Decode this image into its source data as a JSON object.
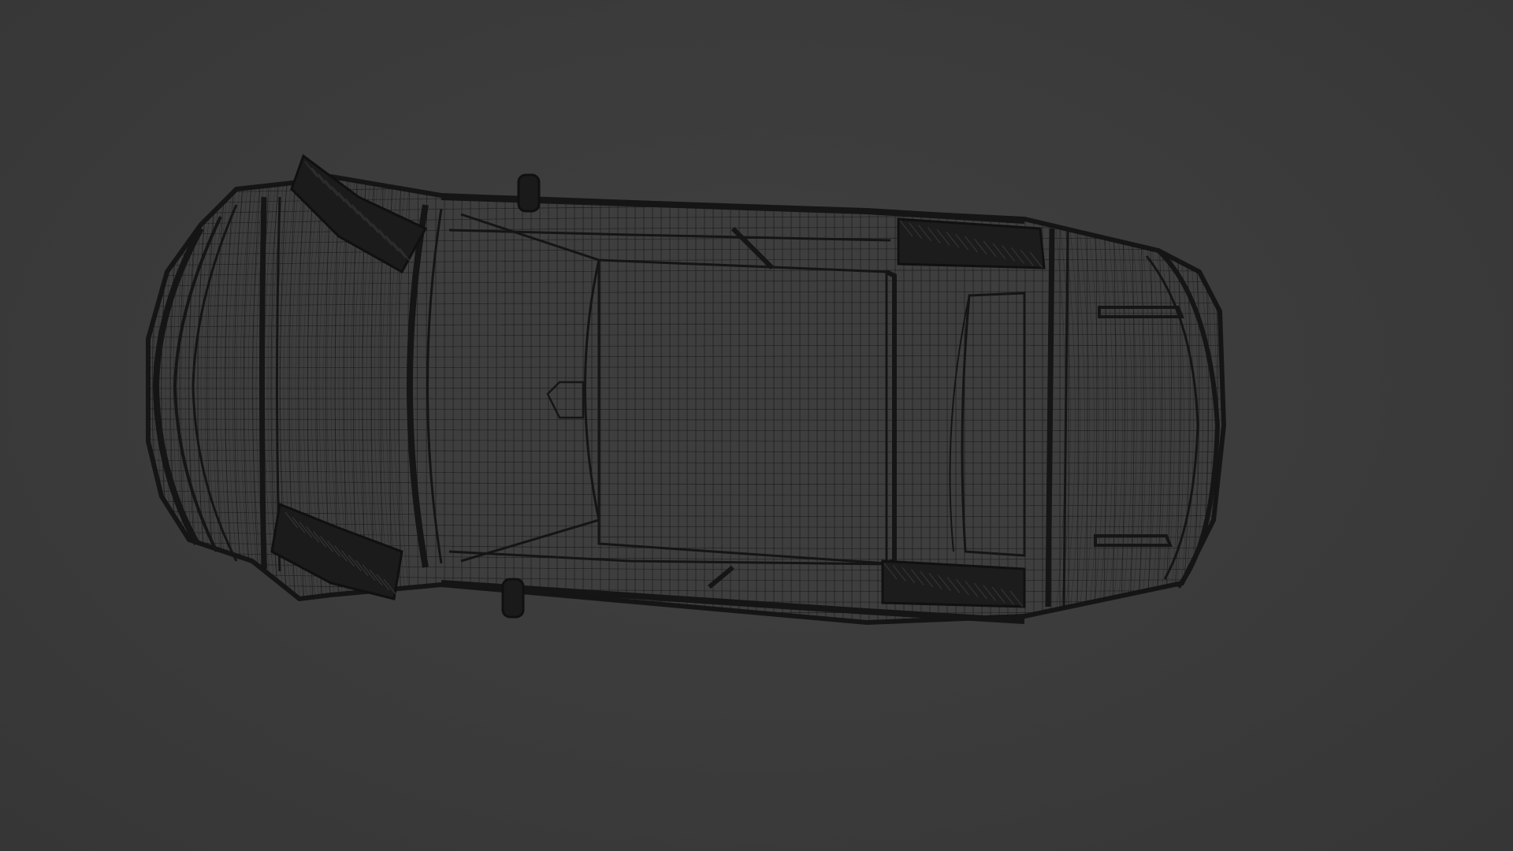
{
  "viewport": {
    "background_color": "#3c3c3c",
    "mode": "wireframe",
    "model": {
      "subject": "car",
      "view": "top",
      "wire_color": "#141414"
    }
  }
}
